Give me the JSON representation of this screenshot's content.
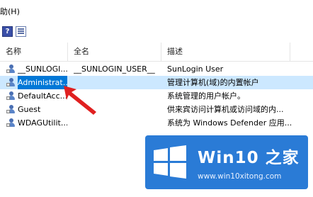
{
  "menu": {
    "help_label": "助(H)"
  },
  "toolbar": {
    "help_icon_glyph": "?"
  },
  "columns": [
    {
      "label": "名称"
    },
    {
      "label": "全名"
    },
    {
      "label": "描述"
    }
  ],
  "rows": [
    {
      "name": "__SUNLOGI...",
      "full_name": "__SUNLOGIN_USER__",
      "description": "SunLogin User",
      "selected": false
    },
    {
      "name": "Administrat...",
      "full_name": "",
      "description": "管理计算机(域)的内置帐户",
      "selected": true
    },
    {
      "name": "DefaultAcc...",
      "full_name": "",
      "description": "系统管理的用户帐户。",
      "selected": false
    },
    {
      "name": "Guest",
      "full_name": "",
      "description": "供来宾访问计算机或访问域的内...",
      "selected": false
    },
    {
      "name": "WDAGUtilit...",
      "full_name": "",
      "description": "系统为 Windows Defender 应用...",
      "selected": false
    }
  ],
  "watermark": {
    "title": "Win10 之家",
    "url": "www.win10xitong.com",
    "brand_color": "#2a7bd6"
  },
  "colors": {
    "selection": "#cce8ff",
    "arrow": "#e02020"
  }
}
